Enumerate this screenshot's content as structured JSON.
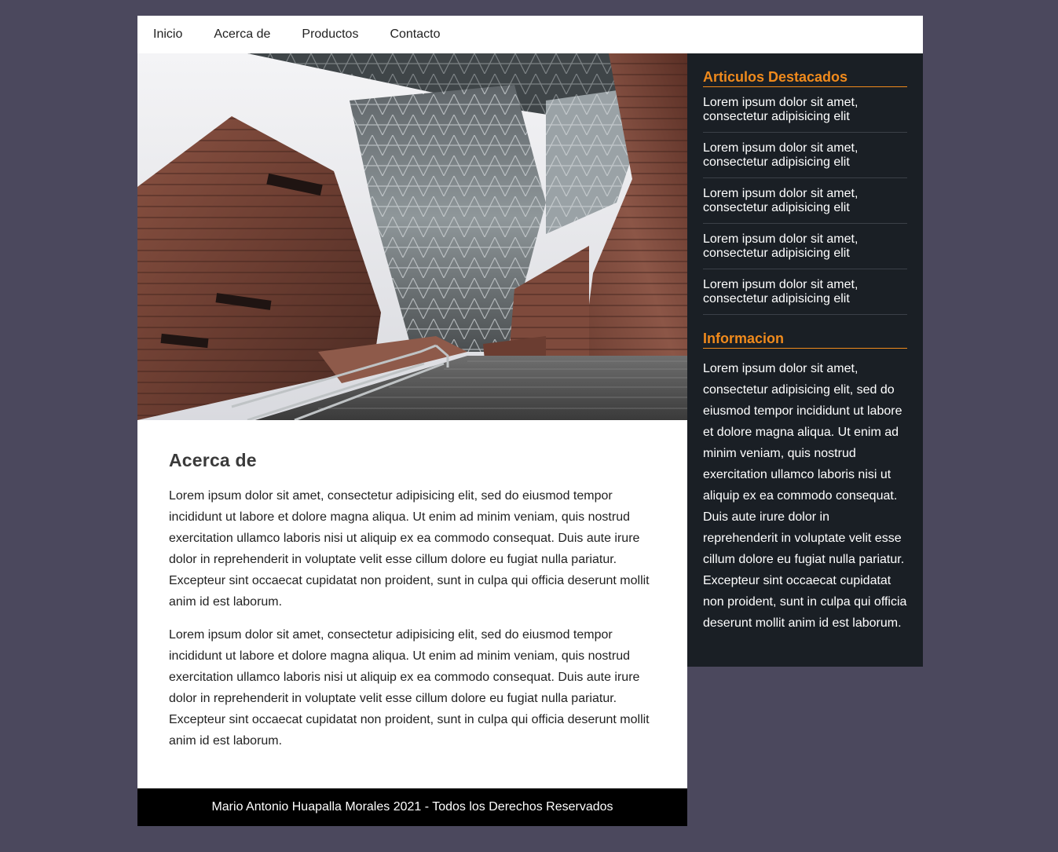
{
  "nav": {
    "items": [
      "Inicio",
      "Acerca de",
      "Productos",
      "Contacto"
    ]
  },
  "main": {
    "title": "Acerca de",
    "paragraphs": [
      "Lorem ipsum dolor sit amet, consectetur adipisicing elit, sed do eiusmod tempor incididunt ut labore et dolore magna aliqua. Ut enim ad minim veniam, quis nostrud exercitation ullamco laboris nisi ut aliquip ex ea commodo consequat. Duis aute irure dolor in reprehenderit in voluptate velit esse cillum dolore eu fugiat nulla pariatur. Excepteur sint occaecat cupidatat non proident, sunt in culpa qui officia deserunt mollit anim id est laborum.",
      "Lorem ipsum dolor sit amet, consectetur adipisicing elit, sed do eiusmod tempor incididunt ut labore et dolore magna aliqua. Ut enim ad minim veniam, quis nostrud exercitation ullamco laboris nisi ut aliquip ex ea commodo consequat. Duis aute irure dolor in reprehenderit in voluptate velit esse cillum dolore eu fugiat nulla pariatur. Excepteur sint occaecat cupidatat non proident, sunt in culpa qui officia deserunt mollit anim id est laborum."
    ]
  },
  "sidebar": {
    "featured_title": "Articulos Destacados",
    "featured_items": [
      "Lorem ipsum dolor sit amet, consectetur adipisicing elit",
      "Lorem ipsum dolor sit amet, consectetur adipisicing elit",
      "Lorem ipsum dolor sit amet, consectetur adipisicing elit",
      "Lorem ipsum dolor sit amet, consectetur adipisicing elit",
      "Lorem ipsum dolor sit amet, consectetur adipisicing elit"
    ],
    "info_title": "Informacion",
    "info_text": "Lorem ipsum dolor sit amet, consectetur adipisicing elit, sed do eiusmod tempor incididunt ut labore et dolore magna aliqua. Ut enim ad minim veniam, quis nostrud exercitation ullamco laboris nisi ut aliquip ex ea commodo consequat. Duis aute irure dolor in reprehenderit in voluptate velit esse cillum dolore eu fugiat nulla pariatur. Excepteur sint occaecat cupidatat non proident, sunt in culpa qui officia deserunt mollit anim id est laborum."
  },
  "footer": {
    "text": "Mario Antonio Huapalla Morales 2021 - Todos los Derechos Reservados"
  },
  "colors": {
    "background": "#4b485d",
    "sidebar": "#1a1f25",
    "accent": "#f08a1c",
    "footer": "#000000"
  }
}
